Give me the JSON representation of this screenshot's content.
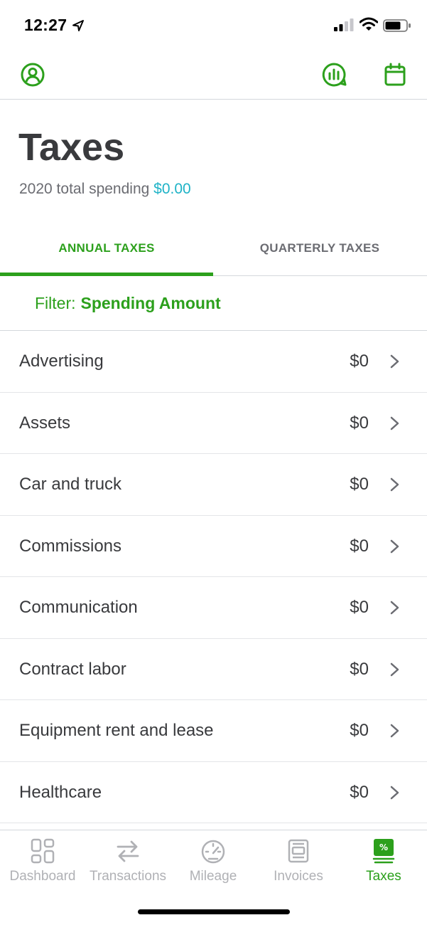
{
  "status_bar": {
    "time": "12:27"
  },
  "header": {
    "profile_icon": "profile-icon",
    "reports_icon": "reports-icon",
    "calendar_icon": "calendar-icon"
  },
  "page": {
    "title": "Taxes",
    "summary_label": "2020 total spending",
    "summary_amount": "$0.00"
  },
  "tabs": [
    {
      "label": "ANNUAL TAXES",
      "active": true
    },
    {
      "label": "QUARTERLY TAXES",
      "active": false
    }
  ],
  "filter": {
    "label": "Filter:",
    "value": "Spending Amount"
  },
  "categories": [
    {
      "label": "Advertising",
      "value": "$0"
    },
    {
      "label": "Assets",
      "value": "$0"
    },
    {
      "label": "Car and truck",
      "value": "$0"
    },
    {
      "label": "Commissions",
      "value": "$0"
    },
    {
      "label": "Communication",
      "value": "$0"
    },
    {
      "label": "Contract labor",
      "value": "$0"
    },
    {
      "label": "Equipment rent and lease",
      "value": "$0"
    },
    {
      "label": "Healthcare",
      "value": "$0"
    }
  ],
  "bottom_nav": [
    {
      "label": "Dashboard",
      "icon": "dashboard-icon",
      "active": false
    },
    {
      "label": "Transactions",
      "icon": "transactions-icon",
      "active": false
    },
    {
      "label": "Mileage",
      "icon": "mileage-icon",
      "active": false
    },
    {
      "label": "Invoices",
      "icon": "invoices-icon",
      "active": false
    },
    {
      "label": "Taxes",
      "icon": "taxes-icon",
      "active": true
    }
  ],
  "colors": {
    "accent": "#2ca01c",
    "amount": "#1fb3c7",
    "inactive": "#b0b1b5",
    "text": "#393a3d"
  }
}
